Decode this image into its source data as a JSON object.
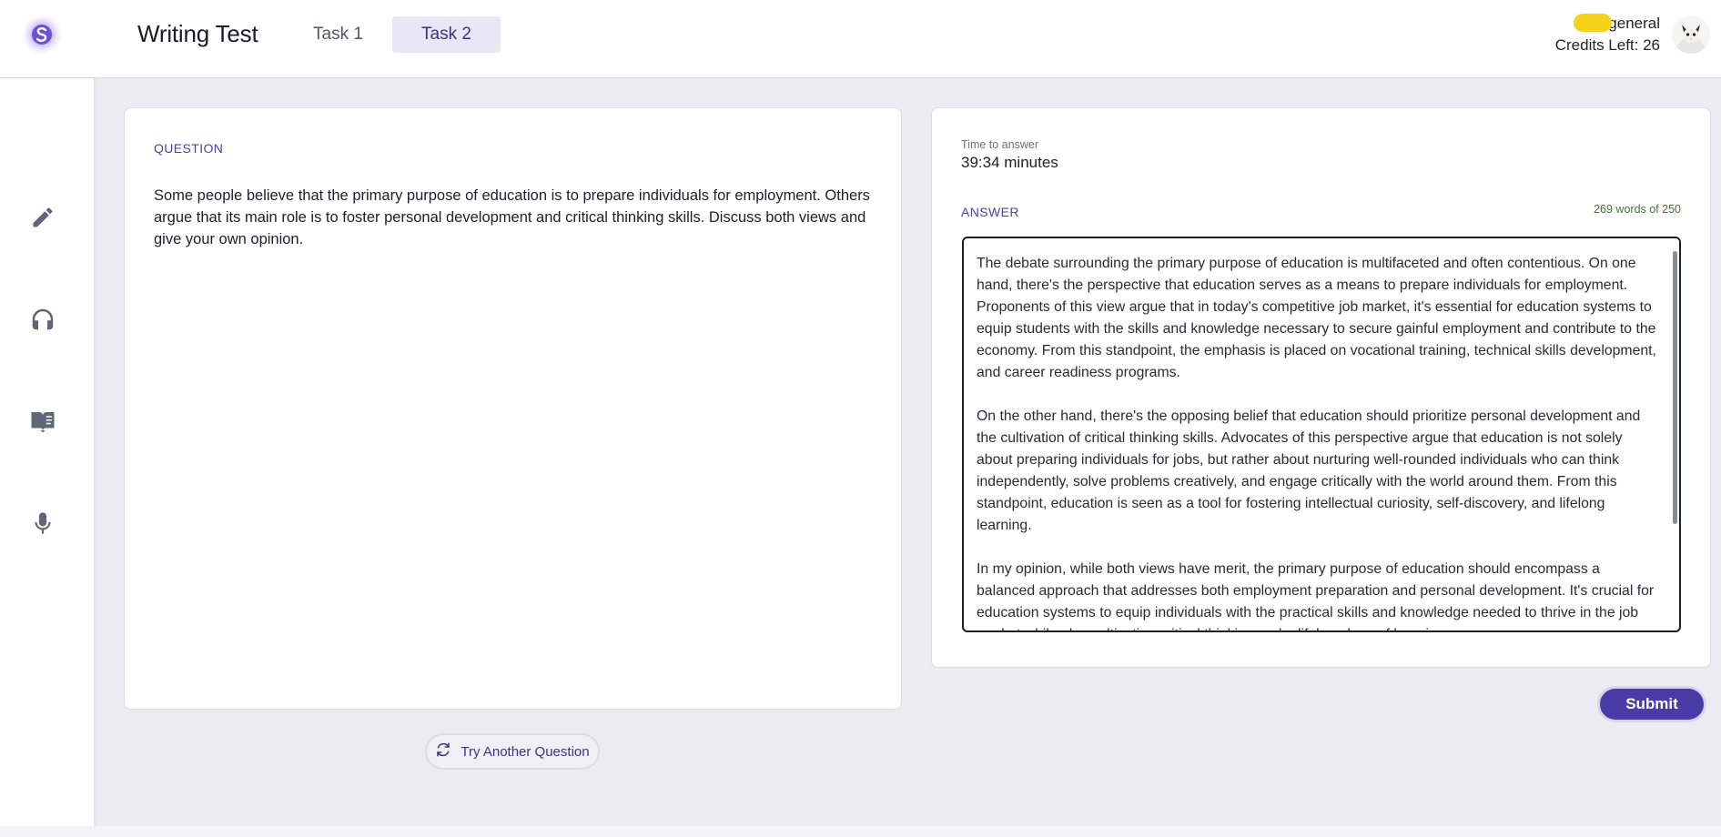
{
  "header": {
    "title": "Writing Test",
    "tabs": [
      {
        "label": "Task 1",
        "active": false
      },
      {
        "label": "Task 2",
        "active": true
      }
    ],
    "user": {
      "name": "general",
      "credits": "Credits Left: 26"
    }
  },
  "sidebar": {
    "items": [
      {
        "icon": "pencil-icon"
      },
      {
        "icon": "headphones-icon"
      },
      {
        "icon": "book-icon"
      },
      {
        "icon": "microphone-icon"
      }
    ]
  },
  "question": {
    "label": "QUESTION",
    "text": "Some people believe that the primary purpose of education is to prepare individuals for employment. Others argue that its main role is to foster personal development and critical thinking skills. Discuss both views and give your own opinion."
  },
  "answer": {
    "time_label": "Time to answer",
    "time_value": "39:34 minutes",
    "label": "ANSWER",
    "word_count": "269 words of 250",
    "text": "The debate surrounding the primary purpose of education is multifaceted and often contentious. On one hand, there's the perspective that education serves as a means to prepare individuals for employment. Proponents of this view argue that in today's competitive job market, it's essential for education systems to equip students with the skills and knowledge necessary to secure gainful employment and contribute to the economy. From this standpoint, the emphasis is placed on vocational training, technical skills development, and career readiness programs.\n\nOn the other hand, there's the opposing belief that education should prioritize personal development and the cultivation of critical thinking skills. Advocates of this perspective argue that education is not solely about preparing individuals for jobs, but rather about nurturing well-rounded individuals who can think independently, solve problems creatively, and engage critically with the world around them. From this standpoint, education is seen as a tool for fostering intellectual curiosity, self-discovery, and lifelong learning.\n\nIn my opinion, while both views have merit, the primary purpose of education should encompass a balanced approach that addresses both employment preparation and personal development. It's crucial for education systems to equip individuals with the practical skills and knowledge needed to thrive in the job market while also cultivating critical thinking and a lifelong love of learning."
  },
  "actions": {
    "submit_label": "Submit",
    "try_another_label": "Try Another Question"
  },
  "colors": {
    "accent": "#4a3ca6",
    "tab_active_bg": "#e9e7f5",
    "word_count": "#3a7a35"
  }
}
